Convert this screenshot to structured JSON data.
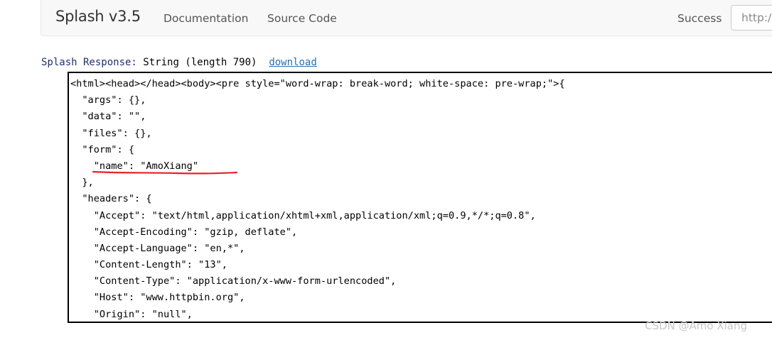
{
  "navbar": {
    "brand": "Splash v3.5",
    "links": [
      "Documentation",
      "Source Code"
    ],
    "status": "Success",
    "url_input_value": "http:/"
  },
  "response": {
    "label": "Splash Response:",
    "description": "String (length 790)",
    "download_label": "download"
  },
  "code_lines": [
    "<html><head></head><body><pre style=\"word-wrap: break-word; white-space: pre-wrap;\">{",
    "  \"args\": {},",
    "  \"data\": \"\",",
    "  \"files\": {},",
    "  \"form\": {",
    "    \"name\": \"AmoXiang\"",
    "  },",
    "  \"headers\": {",
    "    \"Accept\": \"text/html,application/xhtml+xml,application/xml;q=0.9,*/*;q=0.8\",",
    "    \"Accept-Encoding\": \"gzip, deflate\",",
    "    \"Accept-Language\": \"en,*\",",
    "    \"Content-Length\": \"13\",",
    "    \"Content-Type\": \"application/x-www-form-urlencoded\",",
    "    \"Host\": \"www.httpbin.org\",",
    "    \"Origin\": \"null\","
  ],
  "annotation_color": "#e8202a",
  "watermark": "CSDN @Amo Xiang"
}
